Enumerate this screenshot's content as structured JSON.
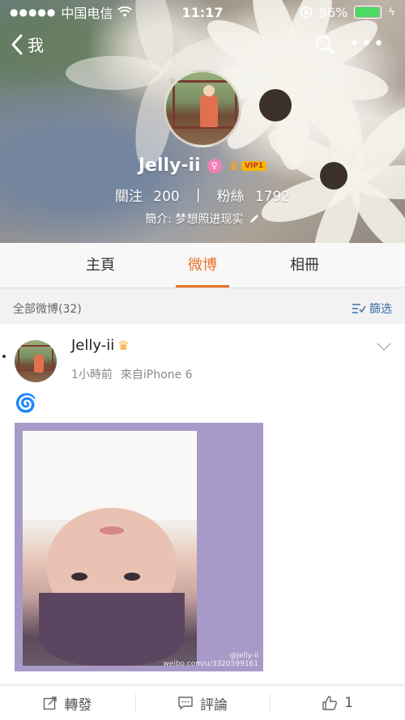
{
  "status_bar": {
    "carrier": "中国电信",
    "time": "11:17",
    "battery": "96%",
    "battery_level": 0.96
  },
  "nav": {
    "back_label": "我",
    "icons": [
      "search-icon",
      "more-icon"
    ]
  },
  "profile": {
    "name": "Jelly-ii",
    "vip_label": "VIP1",
    "following_label": "關注",
    "following_count": "200",
    "separator": "|",
    "followers_label": "粉絲",
    "followers_count": "1792",
    "bio": "簡介: 梦想照进现实"
  },
  "tabs": [
    {
      "label": "主頁",
      "active": false
    },
    {
      "label": "微博",
      "active": true
    },
    {
      "label": "相冊",
      "active": false
    }
  ],
  "filter": {
    "title": "全部微博(32)",
    "button_label": "篩选"
  },
  "post": {
    "author": "Jelly-ii",
    "time": "1小時前",
    "source": "來自iPhone 6",
    "emoji": "🌀",
    "watermark_user": "@Jelly-ii",
    "watermark_url": "weibo.com/u/3320599161"
  },
  "actions": {
    "repost_label": "轉發",
    "comment_label": "評論",
    "like_count": "1"
  },
  "colors": {
    "accent": "#e8742b",
    "link": "#3a6da8",
    "battery": "#4cd964"
  }
}
